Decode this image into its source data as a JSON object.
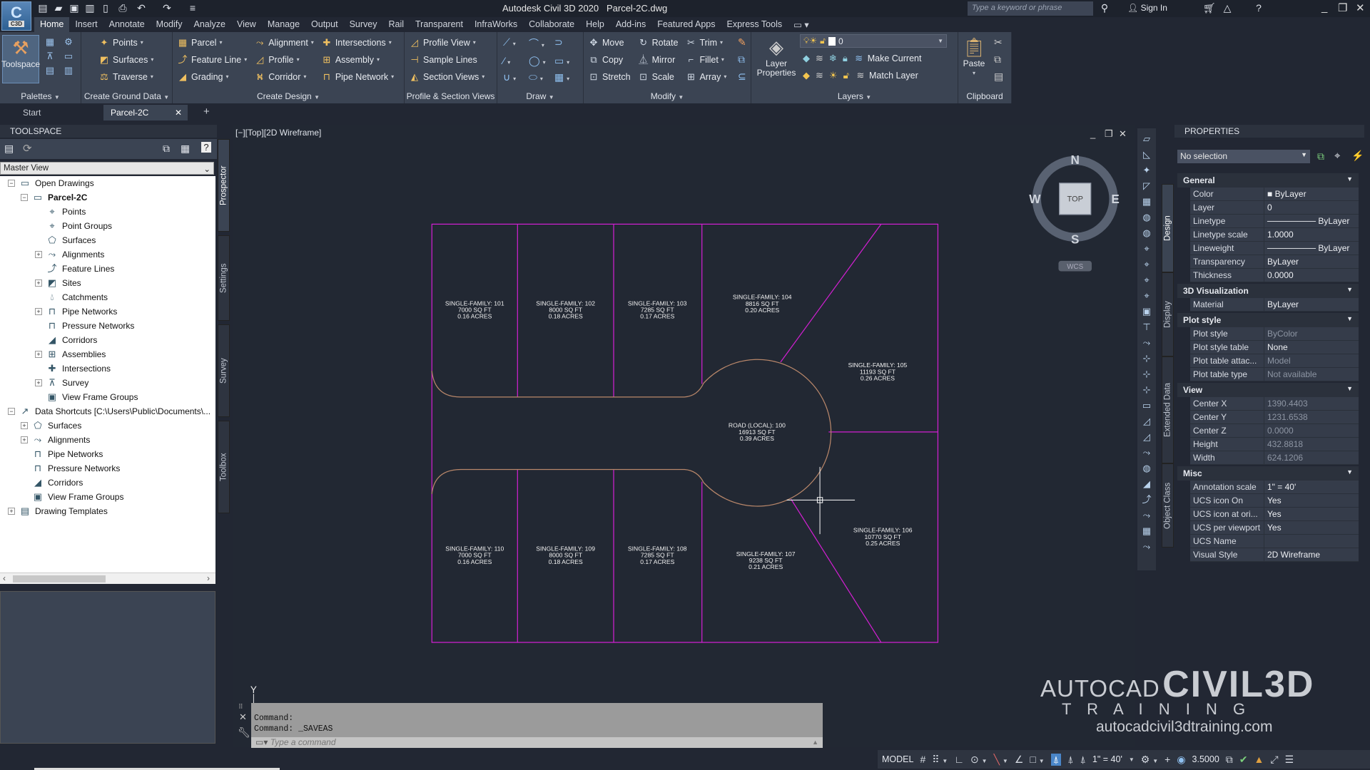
{
  "app": {
    "logo_text": "C3D",
    "title": "Autodesk Civil 3D 2020   Parcel-2C.dwg",
    "search_placeholder": "Type a keyword or phrase",
    "sign_in": "Sign In"
  },
  "menu_tabs": [
    "Home",
    "Insert",
    "Annotate",
    "Modify",
    "Analyze",
    "View",
    "Manage",
    "Output",
    "Survey",
    "Rail",
    "Transparent",
    "InfraWorks",
    "Collaborate",
    "Help",
    "Add-ins",
    "Featured Apps",
    "Express Tools"
  ],
  "active_menu_tab": "Home",
  "ribbon": {
    "palettes": {
      "label": "Palettes",
      "toolspace": "Toolspace"
    },
    "ground": {
      "label": "Create Ground Data",
      "items": [
        "Points",
        "Surfaces",
        "Traverse"
      ]
    },
    "design": {
      "label": "Create Design",
      "cols": [
        [
          "Parcel",
          "Feature Line",
          "Grading"
        ],
        [
          "Alignment",
          "Profile",
          "Corridor"
        ],
        [
          "Intersections",
          "Assembly",
          "Pipe Network"
        ]
      ]
    },
    "profile": {
      "label": "Profile & Section Views",
      "items": [
        "Profile View",
        "Sample Lines",
        "Section Views"
      ]
    },
    "draw": {
      "label": "Draw"
    },
    "modify": {
      "label": "Modify",
      "cols": [
        [
          "Move",
          "Copy",
          "Stretch"
        ],
        [
          "Rotate",
          "Mirror",
          "Scale"
        ],
        [
          "Trim",
          "Fillet",
          "Array"
        ]
      ]
    },
    "layers": {
      "label": "Layers",
      "layer_properties": "Layer Properties",
      "current_layer": "0",
      "make_current": "Make Current",
      "match_layer": "Match Layer"
    },
    "clipboard": {
      "label": "Clipboard",
      "paste": "Paste"
    }
  },
  "doc_tabs": {
    "start": "Start",
    "active": "Parcel-2C"
  },
  "toolspace": {
    "title": "TOOLSPACE",
    "view": "Master View",
    "tree": [
      {
        "label": "Open Drawings",
        "level": 0,
        "exp": "-",
        "icon": "drawings"
      },
      {
        "label": "Parcel-2C",
        "level": 1,
        "exp": "-",
        "icon": "drawing",
        "bold": true
      },
      {
        "label": "Points",
        "level": 2,
        "icon": "points"
      },
      {
        "label": "Point Groups",
        "level": 2,
        "icon": "point-groups"
      },
      {
        "label": "Surfaces",
        "level": 2,
        "icon": "surfaces"
      },
      {
        "label": "Alignments",
        "level": 2,
        "exp": "+",
        "icon": "alignments"
      },
      {
        "label": "Feature Lines",
        "level": 2,
        "icon": "feature-lines"
      },
      {
        "label": "Sites",
        "level": 2,
        "exp": "+",
        "icon": "sites"
      },
      {
        "label": "Catchments",
        "level": 2,
        "icon": "catchments"
      },
      {
        "label": "Pipe Networks",
        "level": 2,
        "exp": "+",
        "icon": "pipe-networks"
      },
      {
        "label": "Pressure Networks",
        "level": 2,
        "icon": "pressure-networks"
      },
      {
        "label": "Corridors",
        "level": 2,
        "icon": "corridors"
      },
      {
        "label": "Assemblies",
        "level": 2,
        "exp": "+",
        "icon": "assemblies"
      },
      {
        "label": "Intersections",
        "level": 2,
        "icon": "intersections"
      },
      {
        "label": "Survey",
        "level": 2,
        "exp": "+",
        "icon": "survey"
      },
      {
        "label": "View Frame Groups",
        "level": 2,
        "icon": "view-frames"
      },
      {
        "label": "Data Shortcuts [C:\\Users\\Public\\Documents\\...",
        "level": 0,
        "exp": "-",
        "icon": "shortcut"
      },
      {
        "label": "Surfaces",
        "level": 1,
        "exp": "+",
        "icon": "surfaces"
      },
      {
        "label": "Alignments",
        "level": 1,
        "exp": "+",
        "icon": "alignments"
      },
      {
        "label": "Pipe Networks",
        "level": 1,
        "icon": "pipe-networks"
      },
      {
        "label": "Pressure Networks",
        "level": 1,
        "icon": "pressure-networks"
      },
      {
        "label": "Corridors",
        "level": 1,
        "icon": "corridors"
      },
      {
        "label": "View Frame Groups",
        "level": 1,
        "icon": "view-frames"
      },
      {
        "label": "Drawing Templates",
        "level": 0,
        "exp": "+",
        "icon": "templates"
      }
    ],
    "side_tabs": [
      "Prospector",
      "Settings",
      "Survey",
      "Toolbox"
    ]
  },
  "viewport": {
    "label": "[−][Top][2D Wireframe]",
    "viewcube": {
      "n": "N",
      "s": "S",
      "e": "E",
      "w": "W",
      "face": "TOP",
      "wcs": "WCS"
    },
    "ucs_y": "Y",
    "parcels": [
      {
        "name": "SINGLE-FAMILY: 101",
        "area": "7000 SQ FT",
        "acres": "0.16 ACRES"
      },
      {
        "name": "SINGLE-FAMILY: 102",
        "area": "8000 SQ FT",
        "acres": "0.18 ACRES"
      },
      {
        "name": "SINGLE-FAMILY: 103",
        "area": "7285 SQ FT",
        "acres": "0.17 ACRES"
      },
      {
        "name": "SINGLE-FAMILY: 104",
        "area": "8816 SQ FT",
        "acres": "0.20 ACRES"
      },
      {
        "name": "SINGLE-FAMILY: 105",
        "area": "11193 SQ FT",
        "acres": "0.26 ACRES"
      },
      {
        "name": "ROAD (LOCAL): 100",
        "area": "16913 SQ FT",
        "acres": "0.39 ACRES"
      },
      {
        "name": "SINGLE-FAMILY: 106",
        "area": "10770 SQ FT",
        "acres": "0.25 ACRES"
      },
      {
        "name": "SINGLE-FAMILY: 107",
        "area": "9238 SQ FT",
        "acres": "0.21 ACRES"
      },
      {
        "name": "SINGLE-FAMILY: 108",
        "area": "7285 SQ FT",
        "acres": "0.17 ACRES"
      },
      {
        "name": "SINGLE-FAMILY: 109",
        "area": "8000 SQ FT",
        "acres": "0.18 ACRES"
      },
      {
        "name": "SINGLE-FAMILY: 110",
        "area": "7000 SQ FT",
        "acres": "0.16 ACRES"
      }
    ],
    "colors": {
      "parcel_line": "#d21fd2",
      "road_line": "#b9876a",
      "background": "#222833"
    }
  },
  "watermark": {
    "line1a": "AUTOCAD",
    "line1b": "CIVIL3D",
    "line2": "T R A I N I N G",
    "url": "autocadcivil3dtraining.com"
  },
  "command": {
    "history": [
      "Command:",
      "Command: _SAVEAS"
    ],
    "placeholder": "Type a command"
  },
  "properties": {
    "title": "PROPERTIES",
    "selection": "No selection",
    "side_tabs": [
      "Design",
      "Display",
      "Extended Data",
      "Object Class"
    ],
    "sections": [
      {
        "name": "General",
        "rows": [
          [
            "Color",
            "■ ByLayer"
          ],
          [
            "Layer",
            "0"
          ],
          [
            "Linetype",
            "──────── ByLayer"
          ],
          [
            "Linetype scale",
            "1.0000"
          ],
          [
            "Lineweight",
            "──────── ByLayer"
          ],
          [
            "Transparency",
            "ByLayer"
          ],
          [
            "Thickness",
            "0.0000"
          ]
        ]
      },
      {
        "name": "3D Visualization",
        "rows": [
          [
            "Material",
            "ByLayer"
          ]
        ]
      },
      {
        "name": "Plot style",
        "rows": [
          [
            "Plot style",
            "ByColor",
            1
          ],
          [
            "Plot style table",
            "None"
          ],
          [
            "Plot table attac...",
            "Model",
            1
          ],
          [
            "Plot table type",
            "Not available",
            1
          ]
        ]
      },
      {
        "name": "View",
        "rows": [
          [
            "Center X",
            "1390.4403",
            1
          ],
          [
            "Center Y",
            "1231.6538",
            1
          ],
          [
            "Center Z",
            "0.0000",
            1
          ],
          [
            "Height",
            "432.8818",
            1
          ],
          [
            "Width",
            "624.1206",
            1
          ]
        ]
      },
      {
        "name": "Misc",
        "rows": [
          [
            "Annotation scale",
            "1\" = 40'"
          ],
          [
            "UCS icon On",
            "Yes"
          ],
          [
            "UCS icon at ori...",
            "Yes"
          ],
          [
            "UCS per viewport",
            "Yes"
          ],
          [
            "UCS Name",
            ""
          ],
          [
            "Visual Style",
            "2D Wireframe"
          ]
        ]
      }
    ]
  },
  "statusbar": {
    "model": "MODEL",
    "annotation_scale": "1\" = 40'",
    "value": "3.5000"
  }
}
